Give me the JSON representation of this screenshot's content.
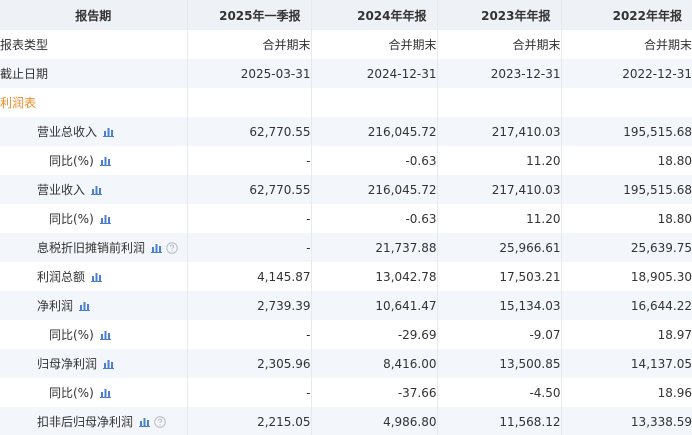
{
  "header": {
    "label": "报告期",
    "columns": [
      "2025年一季报",
      "2024年年报",
      "2023年年报",
      "2022年年报"
    ]
  },
  "meta_rows": [
    {
      "label": "报表类型",
      "values": [
        "合并期末",
        "合并期末",
        "合并期末",
        "合并期末"
      ]
    },
    {
      "label": "截止日期",
      "values": [
        "2025-03-31",
        "2024-12-31",
        "2023-12-31",
        "2022-12-31"
      ]
    }
  ],
  "section_title": "利润表",
  "rows": [
    {
      "label": "营业总收入",
      "values": [
        "62,770.55",
        "216,045.72",
        "217,410.03",
        "195,515.68"
      ]
    },
    {
      "label": "同比(%)",
      "values": [
        "-",
        "-0.63",
        "11.20",
        "18.80"
      ]
    },
    {
      "label": "营业收入",
      "values": [
        "62,770.55",
        "216,045.72",
        "217,410.03",
        "195,515.68"
      ]
    },
    {
      "label": "同比(%)",
      "values": [
        "-",
        "-0.63",
        "11.20",
        "18.80"
      ]
    },
    {
      "label": "息税折旧摊销前利润",
      "values": [
        "-",
        "21,737.88",
        "25,966.61",
        "25,639.75"
      ]
    },
    {
      "label": "利润总额",
      "values": [
        "4,145.87",
        "13,042.78",
        "17,503.21",
        "18,905.30"
      ]
    },
    {
      "label": "净利润",
      "values": [
        "2,739.39",
        "10,641.47",
        "15,134.03",
        "16,644.22"
      ]
    },
    {
      "label": "同比(%)",
      "values": [
        "-",
        "-29.69",
        "-9.07",
        "18.97"
      ]
    },
    {
      "label": "归母净利润",
      "values": [
        "2,305.96",
        "8,416.00",
        "13,500.85",
        "14,137.05"
      ]
    },
    {
      "label": "同比(%)",
      "values": [
        "-",
        "-37.66",
        "-4.50",
        "18.96"
      ]
    },
    {
      "label": "扣非后归母净利润",
      "values": [
        "2,215.05",
        "4,986.80",
        "11,568.12",
        "13,338.59"
      ]
    }
  ],
  "colors": {
    "header_bg": "#eef1f6",
    "row_shade": "#f3f6fa",
    "section_title": "#f08a26",
    "chart_icon": "#4a7fd4",
    "help_icon": "#b7bcc6"
  },
  "icons": {
    "chart": "bar-chart-icon",
    "help": "question-circle-icon"
  }
}
